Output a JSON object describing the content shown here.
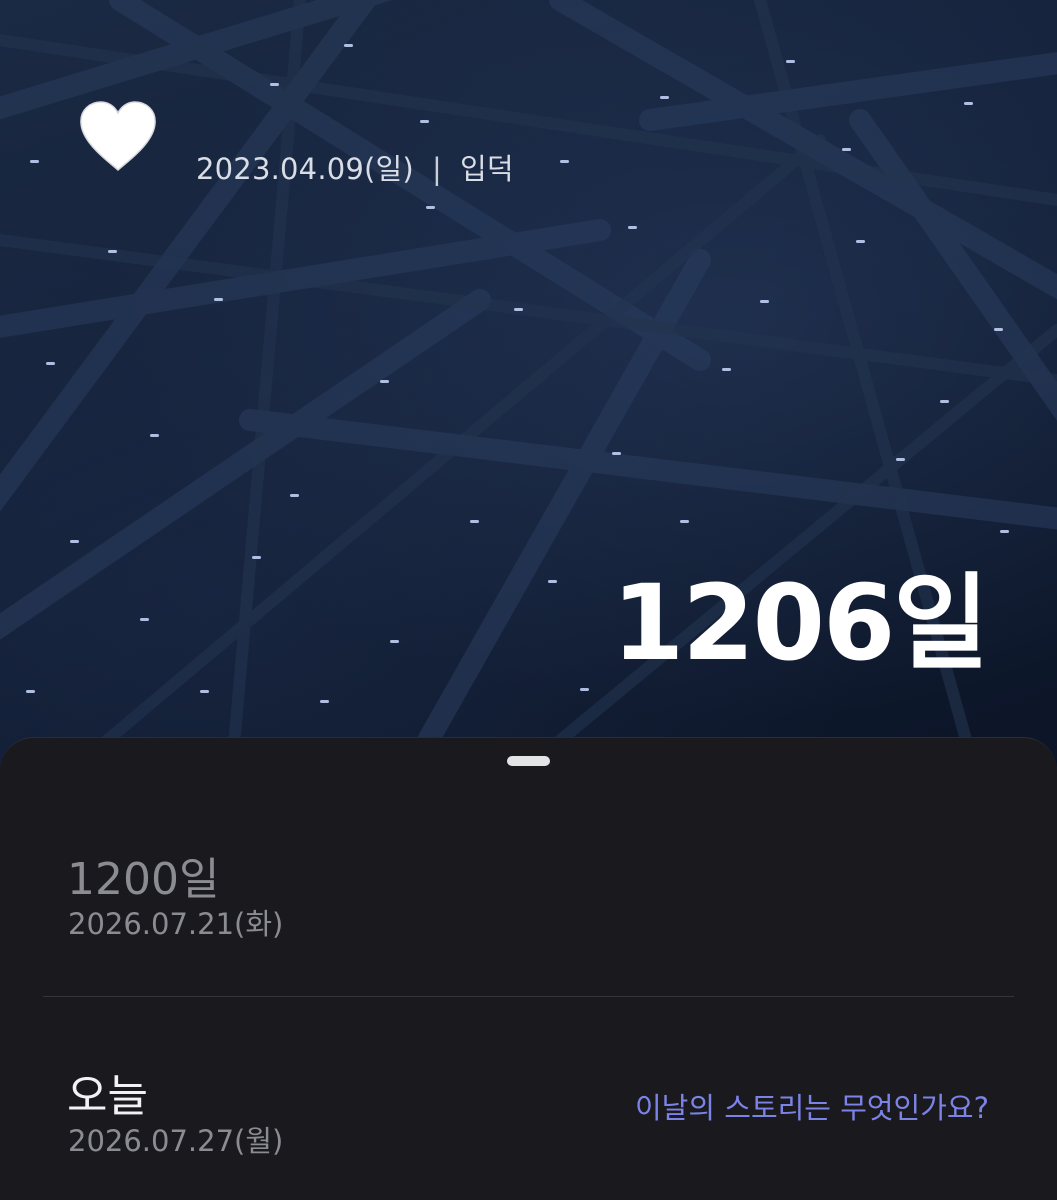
{
  "header": {
    "start_date": "2023.04.09(일)",
    "separator": "|",
    "start_label": "입덕",
    "heart_icon": "heart-icon"
  },
  "dday": {
    "count_label": "1206일"
  },
  "sheet": {
    "milestone": {
      "title": "1200일",
      "date": "2026.07.21(화)"
    },
    "today": {
      "title": "오늘",
      "date": "2026.07.27(월)",
      "story_prompt": "이날의 스토리는 무엇인가요?"
    }
  },
  "colors": {
    "hero_background": "#14213a",
    "sheet_background": "#1a1a1e",
    "accent_link": "#7b83e6",
    "muted_text": "#8b8c92"
  }
}
